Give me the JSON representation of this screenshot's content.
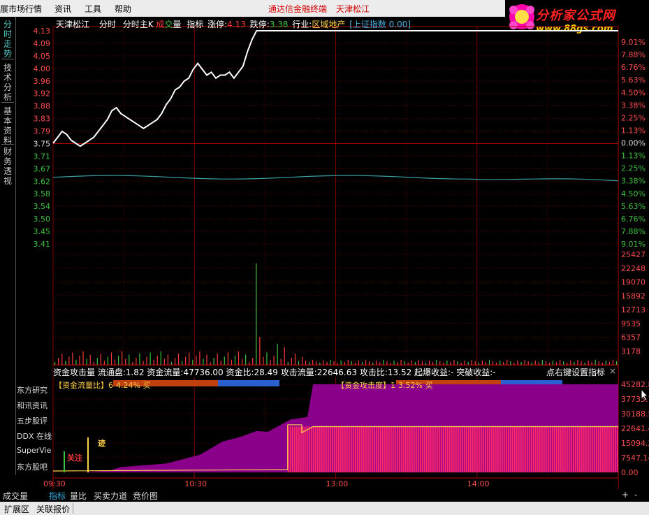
{
  "menu": {
    "items": [
      "展市场行情",
      "资讯",
      "工具",
      "帮助"
    ],
    "title_center": "通达信金融终端",
    "title_stock": "天津松江"
  },
  "logo": {
    "line1": "分析家公式网",
    "line2": "www.88gs.com"
  },
  "left_tabs": [
    "分时走势",
    "技术分析",
    "基本资料",
    "财务透视"
  ],
  "header": {
    "stock": "天津松江",
    "items": [
      "分时",
      "分时主K"
    ],
    "cjl_a": "成",
    "cjl_b": "交",
    "cjl_c": "量",
    "zhibiao": "指标",
    "zhangting_label": "涨停:",
    "zhangting_val": "4.13",
    "dieting_label": "跌停:",
    "dieting_val": "3.38",
    "hangye_label": "行业:",
    "hangye_val": "区域地产",
    "index_label": "[上证指数 0.00]"
  },
  "price_axis": [
    "4.13",
    "4.09",
    "4.05",
    "4.00",
    "3.96",
    "3.92",
    "3.88",
    "3.83",
    "3.79",
    "3.75",
    "3.71",
    "3.67",
    "3.62",
    "3.58",
    "3.54",
    "3.50",
    "3.45",
    "3.41"
  ],
  "pct_axis": [
    "9.01%",
    "7.88%",
    "6.76%",
    "5.63%",
    "4.50%",
    "3.38%",
    "2.25%",
    "1.13%",
    "0.00%",
    "1.13%",
    "2.25%",
    "3.38%",
    "4.50%",
    "5.63%",
    "6.76%",
    "7.88%",
    "9.01%"
  ],
  "volume_axis": [
    "25427",
    "22248",
    "19070",
    "15892",
    "12713",
    "9535",
    "6357",
    "3178"
  ],
  "indicator_bar": {
    "text": "资金攻击量  流通盘:1.82  资金流量:47736.00  资金比:28.49  攻击流量:22646.63  攻击比:13.52  起爆收益:-  突破收益:-",
    "right": "点右键设置指标",
    "close": "×"
  },
  "bars": {
    "left_label": "【资金流量比】",
    "left_lead": "6",
    "left_val": "4.24% 买",
    "right_label": "【资金攻击度】",
    "right_lead": "1",
    "right_val": "3.52% 买"
  },
  "indicator_axis": [
    "45282.8",
    "37735.7",
    "30188.5",
    "22641.4",
    "15094.2",
    "7547.14",
    "0.00"
  ],
  "side_list": [
    "东方研究",
    "和讯资讯",
    "五步股评",
    "DDX 在线",
    "SuperVie",
    "东方股吧"
  ],
  "marks": {
    "zhu": "关注",
    "ji": "迹"
  },
  "time_axis": [
    "09:30",
    "10:30",
    "13:00",
    "14:00"
  ],
  "bottom_tabs": [
    "成交量",
    "指标",
    "量比",
    "买卖力道",
    "竞价图"
  ],
  "bottom_tabs_active": 1,
  "zoom": {
    "plus": "+",
    "minus": "-"
  },
  "status": [
    "扩展区",
    "关联报价"
  ],
  "colors": {
    "up": "#ff3b3b",
    "down": "#3fc23f",
    "price_line": "#ffffff",
    "avg_line": "#3aa0a0",
    "purple": "#8b008b",
    "pink": "#ff2a6a"
  },
  "chart_data": {
    "type": "line",
    "price": {
      "ylim": [
        3.38,
        4.13
      ],
      "prev_close": 3.75
    }
  }
}
